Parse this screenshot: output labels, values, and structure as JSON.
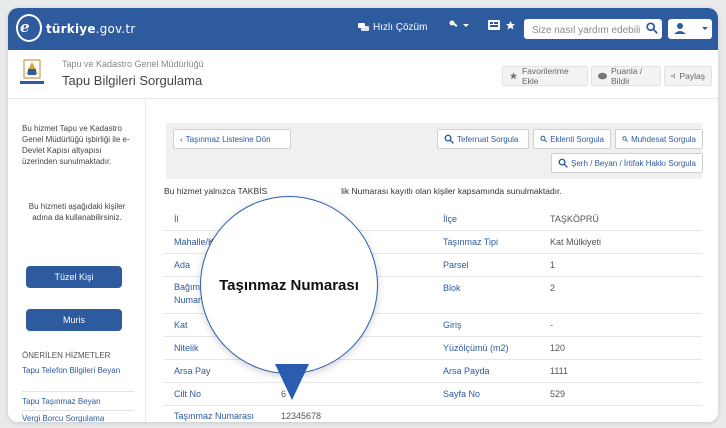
{
  "topbar": {
    "logo_main": "türkiye",
    "logo_tld": ".gov.tr",
    "quick_solution": "Hızlı Çözüm",
    "search_placeholder": "Size nasıl yardım edebilirim?"
  },
  "header": {
    "agency": "Tapu ve Kadastro Genel Müdürlüğü",
    "title": "Tapu Bilgileri Sorgulama",
    "fav": "Favorilerime Ekle",
    "rate": "Puanla / Bildir",
    "share": "Paylaş"
  },
  "sidebar": {
    "info": "Bu hizmet Tapu ve Kadastro Genel Müdürlüğü işbirliği ile e-Devlet Kapısı altyapısı üzerinden sunulmaktadır.",
    "info2": "Bu hizmeti aşağıdaki kişiler adına da kullanabilirsiniz.",
    "btn1": "Tüzel Kişi",
    "btn2": "Muris",
    "recommended": "ÖNERİLEN HİZMETLER",
    "links": [
      "Tapu Telefon Bilgileri Beyan",
      "Tapu Taşınmaz Beyan",
      "Vergi Borcu Sorgulama"
    ]
  },
  "actions": {
    "back": "Taşınmaz Listesine Dön",
    "teferruat": "Teferruat Sorgula",
    "eklenti": "Eklenti Sorgula",
    "muhdesat": "Muhdesat Sorgula",
    "serh": "Şerh / Beyan / İrtifak Hakkı Sorgula"
  },
  "notice": "Bu hizmet yalnızca TAKBİS Taşınmaz Kimlik Numarası kayıtlı olan kişiler kapsamında sunulmaktadır.",
  "notice_visible": "Bu hizmet yalnızca TAKBİS",
  "notice_tail": "lik Numarası kayıtlı olan kişiler kapsamında sunulmaktadır.",
  "rows": [
    {
      "l1": "İl",
      "v1": "",
      "l2": "İlçe",
      "v2": "TAŞKÖPRÜ"
    },
    {
      "l1": "Mahalle/K",
      "v1": "",
      "l2": "Taşınmaz Tipi",
      "v2": "Kat Mülkiyeti"
    },
    {
      "l1": "Ada",
      "v1": "",
      "l2": "Parsel",
      "v2": "1"
    },
    {
      "l1": "Bağımsı Numara",
      "v1": "",
      "l2": "Blok",
      "v2": "2"
    },
    {
      "l1": "Kat",
      "v1": "",
      "l2": "Giriş",
      "v2": "-"
    },
    {
      "l1": "Nitelik",
      "v1": "",
      "l2": "Yüzölçümü (m2)",
      "v2": "120"
    },
    {
      "l1": "Arsa Pay",
      "v1": "",
      "l2": "Arsa Payda",
      "v2": "1111"
    },
    {
      "l1": "Cilt No",
      "v1": "6",
      "l2": "Sayfa No",
      "v2": "529"
    },
    {
      "l1": "Taşınmaz Numarası",
      "v1": "12345678",
      "l2": "",
      "v2": ""
    }
  ],
  "callout": "Taşınmaz Numarası",
  "colors": {
    "brand": "#2e5a9e",
    "callout_border": "#2a5db0"
  }
}
